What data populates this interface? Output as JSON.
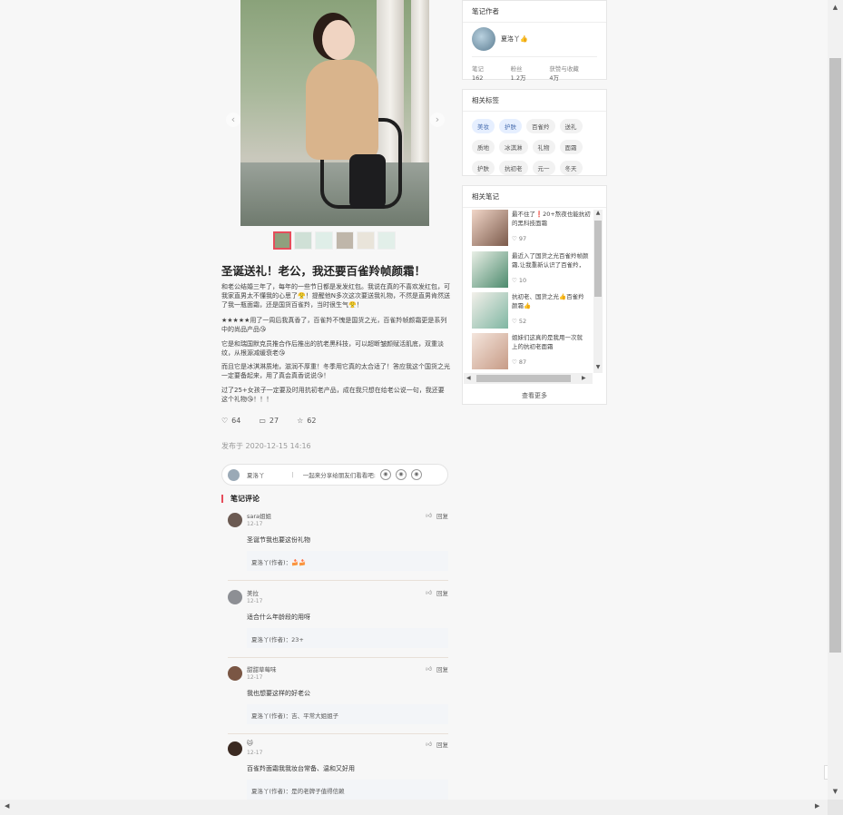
{
  "note": {
    "title": "圣诞送礼！老公，我还要百雀羚帧颜霜！",
    "paragraphs": [
      "和老公结婚三年了，每年的一些节日都是发发红包。我说在真的不喜欢发红包，可我家直男太不懂我的心思了😤！提醒他N多次这次要送我礼物，不然是直男肯然送了我一瓶面霜，还是国货百雀羚，当时很生气😤！",
      "★★★★★用了一周后我真香了，百雀羚不愧是国货之光，百雀羚帧颜霜更是系列中的尚品产品😘",
      "它是和瑞国默克员推合作后推出的抗老黑科技，可以超断皱颜赋活肌底，双重淡纹，从根源减缓衰老😘",
      "而且它是冰淇淋质地，滋润不厚重！冬季用它真的太合适了！答应我这个国货之光一定要备起来，用了真会真香说说😘！",
      "过了25+女孩子一定要及时用抗初老产品，成在我只想在给老公说一句，我还要这个礼物😘！！！"
    ],
    "likes": "64",
    "comments": "27",
    "collects": "62",
    "published": "发布于 2020-12-15 14:16",
    "share_user": "夏洛丫",
    "share_text": "一起来分享给朋友们看看吧:"
  },
  "comments_section": {
    "heading": "笔记评论",
    "items": [
      {
        "name": "sara姐姐",
        "date": "12-17",
        "text": "圣诞节我也要这份礼物",
        "reply": "夏洛丫(作者)：🍰🍰",
        "reply_label": "回复"
      },
      {
        "name": "美拉",
        "date": "12-17",
        "text": "适合什么年龄段的用呀",
        "reply": "夏洛丫(作者)：23+",
        "reply_label": "回复"
      },
      {
        "name": "甜甜草莓味",
        "date": "12-17",
        "text": "我也想要这样的好老公",
        "reply": "夏洛丫(作者)：吉、平常大姐姐子",
        "reply_label": "回复"
      },
      {
        "name": "🐱",
        "date": "12-17",
        "text": "百雀羚面霜我我妆台常备、温和又好用",
        "reply": "夏洛丫(作者)：是的老牌子值得信赖",
        "reply_label": "回复"
      }
    ]
  },
  "author_card": {
    "heading": "笔记作者",
    "name": "夏洛丫👍",
    "stats": [
      {
        "label": "笔记",
        "value": "162"
      },
      {
        "label": "粉丝",
        "value": "1.2万"
      },
      {
        "label": "获赞与收藏",
        "value": "4万"
      }
    ]
  },
  "tags_card": {
    "heading": "相关标签",
    "tags": [
      "美妆",
      "护肤",
      "百雀羚",
      "送礼",
      "质地",
      "冰淇淋",
      "礼物",
      "面霜",
      "护肤",
      "抗初老",
      "元一",
      "冬天"
    ]
  },
  "related_card": {
    "heading": "相关笔记",
    "items": [
      {
        "title": "最不住了❗20+熬夜也能抗初",
        "title2": "的黑科技面霜",
        "likes": "97"
      },
      {
        "title": "最近入了国货之光百雀羚帧颜",
        "title2": "霜,让我重新认识了百雀羚，",
        "likes": "10"
      },
      {
        "title": "抗初老、国货之光👍百雀羚",
        "title2": "颜霜👍",
        "likes": "52"
      },
      {
        "title": "姐妹们这真的是我用一次就",
        "title2": "上的抗初老面霜",
        "likes": "87"
      }
    ],
    "more": "查看更多"
  }
}
